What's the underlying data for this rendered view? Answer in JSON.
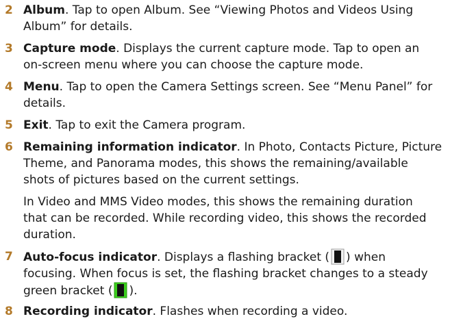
{
  "items": [
    {
      "num": "2",
      "term": "Album",
      "lines": [
        ". Tap to open Album. See “Viewing Photos and Videos Using",
        "Album” for details."
      ]
    },
    {
      "num": "3",
      "term": "Capture mode",
      "lines": [
        ". Displays the current capture mode. Tap to open an",
        "on-screen menu where you can choose the capture mode."
      ]
    },
    {
      "num": "4",
      "term": "Menu",
      "lines": [
        ". Tap to open the Camera Settings screen. See “Menu Panel” for",
        "details."
      ]
    },
    {
      "num": "5",
      "term": "Exit",
      "lines": [
        ". Tap to exit the Camera program."
      ]
    },
    {
      "num": "6",
      "term": "Remaining information indicator",
      "lines": [
        ". In Photo, Contacts Picture, Picture",
        "Theme, and Panorama modes, this shows the remaining/available",
        "shots of pictures based on the current settings."
      ]
    },
    {
      "num": "7",
      "term": "Auto-focus indicator",
      "line1_before": ". Displays a flashing bracket (",
      "line1_after": ") when",
      "line2": "focusing. When focus is set, the flashing bracket changes to a steady",
      "line3_before": "green bracket (",
      "line3_after": ")."
    },
    {
      "num": "8",
      "term": "Recording indicator",
      "lines": [
        ". Flashes when recording a video."
      ]
    }
  ],
  "para6b": [
    "In Video and MMS Video modes, this shows the remaining duration",
    "that can be recorded. While recording video, this shows the recorded",
    "duration."
  ],
  "colors": {
    "number": "#b37a2a",
    "bracket_flashing": "#f2f2f2",
    "bracket_steady": "#3ccf1e",
    "bracket_center": "#111111"
  },
  "icons": [
    "focus-bracket-icon",
    "steady-bracket-icon"
  ]
}
